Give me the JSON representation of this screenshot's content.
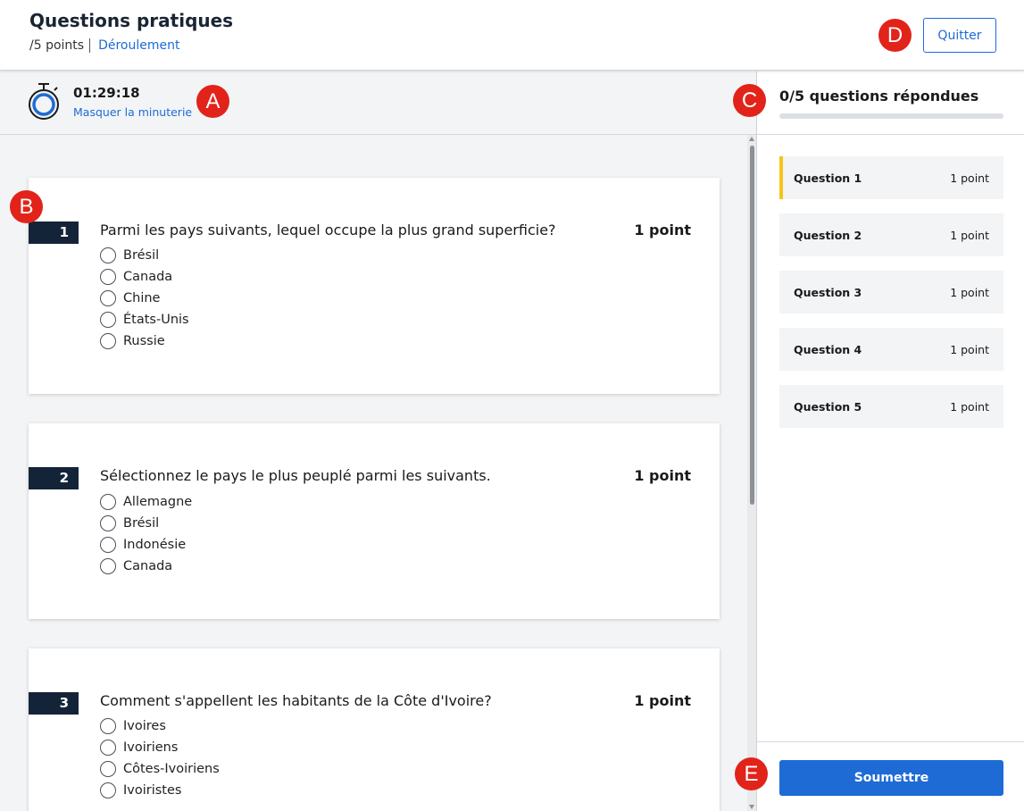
{
  "header": {
    "title": "Questions pratiques",
    "points_total": "/5 points",
    "flow_link": "Déroulement",
    "quit_label": "Quitter"
  },
  "timer": {
    "value": "01:29:18",
    "hide_label": "Masquer la minuterie",
    "icon": "stopwatch-icon"
  },
  "questions": [
    {
      "number": "1",
      "text": "Parmi les pays suivants, lequel occupe la plus grand superficie?",
      "points": "1 point",
      "options": [
        "Brésil",
        "Canada",
        "Chine",
        "États-Unis",
        "Russie"
      ]
    },
    {
      "number": "2",
      "text": "Sélectionnez le pays le plus peuplé parmi les suivants.",
      "points": "1 point",
      "options": [
        "Allemagne",
        "Brésil",
        "Indonésie",
        "Canada"
      ]
    },
    {
      "number": "3",
      "text": "Comment s'appellent les habitants de la Côte d'Ivoire?",
      "points": "1 point",
      "options": [
        "Ivoires",
        "Ivoiriens",
        "Côtes-Ivoiriens",
        "Ivoiristes"
      ]
    }
  ],
  "side_panel": {
    "answered_label": "0/5 questions répondues",
    "progress_fraction": 0,
    "items": [
      {
        "label": "Question 1",
        "points": "1 point",
        "active": true
      },
      {
        "label": "Question 2",
        "points": "1 point",
        "active": false
      },
      {
        "label": "Question 3",
        "points": "1 point",
        "active": false
      },
      {
        "label": "Question 4",
        "points": "1 point",
        "active": false
      },
      {
        "label": "Question 5",
        "points": "1 point",
        "active": false
      }
    ],
    "submit_label": "Soumettre"
  },
  "markers": [
    "A",
    "B",
    "C",
    "D",
    "E"
  ],
  "colors": {
    "accent": "#1e6bd6",
    "active_indicator": "#f5c518",
    "question_badge": "#142438",
    "marker": "#e2231a"
  }
}
